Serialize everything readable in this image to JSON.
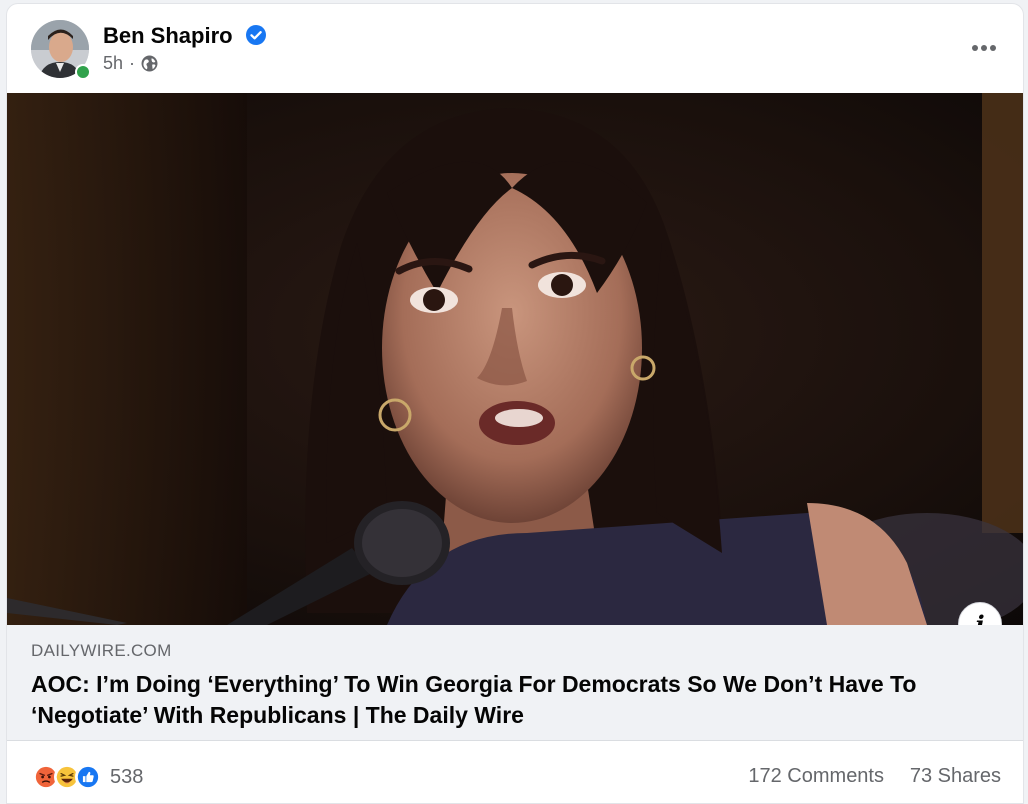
{
  "post": {
    "author": "Ben Shapiro",
    "time": "5h",
    "separator": "·",
    "visibility_icon": "globe-icon",
    "verified_icon": "verified-badge-icon",
    "more_icon": "more-options-icon"
  },
  "link": {
    "domain": "DAILYWIRE.COM",
    "title": "AOC: I’m Doing ‘Everything’ To Win Georgia For Democrats So We Don’t Have To ‘Negotiate’ With Republicans | The Daily Wire",
    "info_label": "i"
  },
  "stats": {
    "reaction_icons": [
      "angry-reaction-icon",
      "haha-reaction-icon",
      "like-reaction-icon"
    ],
    "reaction_count": "538",
    "comments": "172 Comments",
    "shares": "73 Shares"
  },
  "colors": {
    "accent": "#1877f2",
    "online": "#31a24c",
    "secondary_text": "#65676b",
    "link_bg": "#f0f2f5"
  }
}
